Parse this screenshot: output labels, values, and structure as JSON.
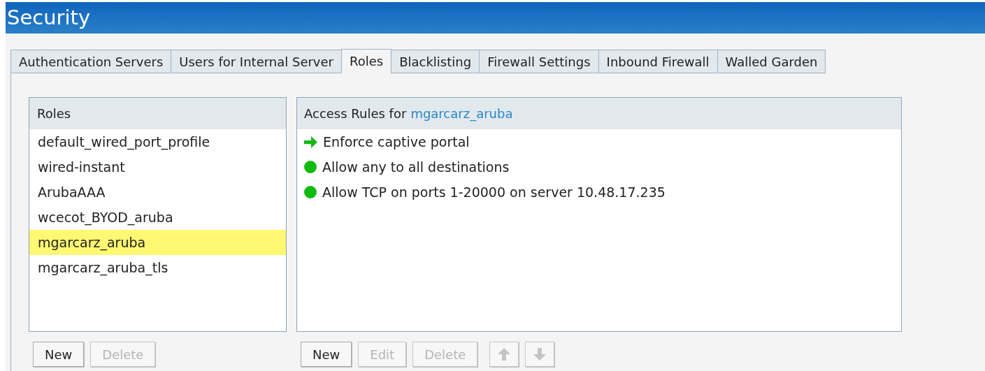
{
  "window": {
    "title": "Security"
  },
  "tabs": [
    {
      "label": "Authentication Servers",
      "selected": false
    },
    {
      "label": "Users for Internal Server",
      "selected": false
    },
    {
      "label": "Roles",
      "selected": true
    },
    {
      "label": "Blacklisting",
      "selected": false
    },
    {
      "label": "Firewall Settings",
      "selected": false
    },
    {
      "label": "Inbound Firewall",
      "selected": false
    },
    {
      "label": "Walled Garden",
      "selected": false
    }
  ],
  "roles": {
    "title": "Roles",
    "items": [
      {
        "label": "default_wired_port_profile",
        "selected": false
      },
      {
        "label": "wired-instant",
        "selected": false
      },
      {
        "label": "ArubaAAA",
        "selected": false
      },
      {
        "label": "wcecot_BYOD_aruba",
        "selected": false
      },
      {
        "label": "mgarcarz_aruba",
        "selected": true
      },
      {
        "label": "mgarcarz_aruba_tls",
        "selected": false
      }
    ],
    "buttons": [
      {
        "kind": "text",
        "label": "New",
        "disabled": false
      },
      {
        "kind": "text",
        "label": "Delete",
        "disabled": true
      }
    ]
  },
  "access_rules": {
    "title": "Access Rules for",
    "role": "mgarcarz_aruba",
    "rules": [
      {
        "kind": "redirect",
        "label": "Enforce captive portal"
      },
      {
        "kind": "allow",
        "label": "Allow any to all destinations"
      },
      {
        "kind": "allow",
        "label": "Allow TCP on ports 1-20000 on server 10.48.17.235"
      }
    ],
    "buttons": [
      {
        "kind": "text",
        "label": "New",
        "disabled": false
      },
      {
        "kind": "text",
        "label": "Edit",
        "disabled": true
      },
      {
        "kind": "text",
        "label": "Delete",
        "disabled": true
      },
      {
        "kind": "up",
        "disabled": true
      },
      {
        "kind": "down",
        "disabled": true
      }
    ]
  }
}
